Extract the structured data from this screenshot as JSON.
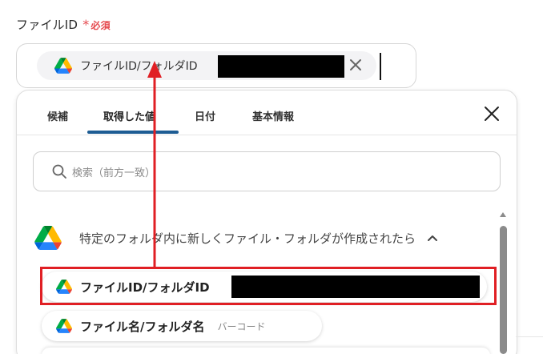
{
  "field": {
    "label": "ファイルID",
    "required_star": "*",
    "required_text": "必須"
  },
  "chip": {
    "icon": "google-drive-icon",
    "text": "ファイルID/フォルダID"
  },
  "panel": {
    "tabs": [
      {
        "label": "候補"
      },
      {
        "label": "取得した値",
        "active": true
      },
      {
        "label": "日付"
      },
      {
        "label": "基本情報"
      }
    ],
    "search": {
      "placeholder": "検索（前方一致）"
    },
    "section": {
      "title": "特定のフォルダ内に新しくファイル・フォルダが作成されたら"
    },
    "items": [
      {
        "label": "ファイルID/フォルダID",
        "value": ""
      },
      {
        "label": "ファイル名/フォルダ名",
        "value": "バーコード"
      }
    ]
  },
  "colors": {
    "required": "#e5484d",
    "tab_underline": "#1d5c93",
    "highlight": "#e01f24",
    "drive_green": "#1fa463",
    "drive_yellow": "#ffd04b",
    "drive_blue": "#4688f1"
  }
}
